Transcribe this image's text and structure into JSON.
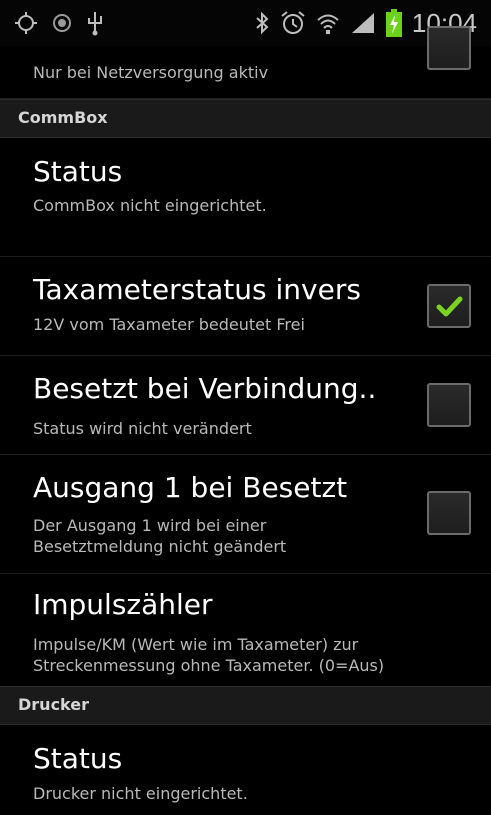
{
  "statusbar": {
    "time": "10:04",
    "left_icons": [
      "gps-icon",
      "nfc-icon",
      "usb-icon"
    ],
    "right_icons": [
      "bluetooth-icon",
      "alarm-icon",
      "wifi-icon",
      "signal-icon",
      "battery-charging-icon"
    ]
  },
  "top_item": {
    "summary": "Nur bei Netzversorgung aktiv",
    "checked": false
  },
  "categories": {
    "commbox": "CommBox",
    "drucker": "Drucker"
  },
  "items": {
    "commbox_status": {
      "title": "Status",
      "summary": "CommBox nicht eingerichtet."
    },
    "taxameter_invers": {
      "title": "Taxameterstatus invers",
      "summary": "12V vom Taxameter bedeutet Frei",
      "checked": true
    },
    "besetzt_verbindung": {
      "title": "Besetzt bei Verbindung..",
      "summary": "Status wird nicht verändert",
      "checked": false
    },
    "ausgang1": {
      "title": "Ausgang 1 bei Besetzt",
      "summary": "Der Ausgang 1 wird bei einer Besetztmeldung nicht geändert",
      "checked": false
    },
    "impulszaehler": {
      "title": "Impulszähler",
      "summary": "Impulse/KM (Wert wie im Taxameter) zur Streckenmessung ohne Taxameter. (0=Aus)"
    },
    "drucker_status": {
      "title": "Status",
      "summary": "Drucker nicht eingerichtet."
    }
  },
  "colors": {
    "accent_check": "#7ad321",
    "background": "#000000",
    "category_bg": "#1a1a1a"
  }
}
